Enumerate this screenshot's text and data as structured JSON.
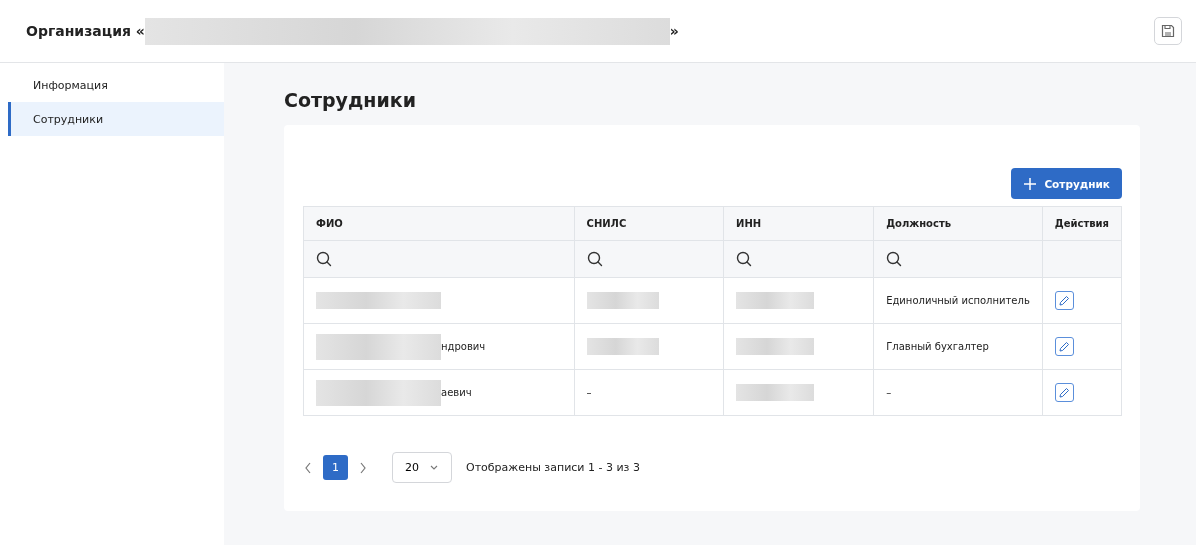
{
  "header": {
    "title_prefix": "Организация «",
    "title_redacted": true,
    "title_suffix": "»"
  },
  "sidebar": {
    "items": [
      {
        "label": "Информация",
        "selected": false
      },
      {
        "label": "Сотрудники",
        "selected": true
      }
    ]
  },
  "page_title": "Сотрудники",
  "add_button": {
    "label": "Сотрудник"
  },
  "table": {
    "columns": [
      {
        "label": "ФИО",
        "searchable": true
      },
      {
        "label": "СНИЛС",
        "searchable": true
      },
      {
        "label": "ИНН",
        "searchable": true
      },
      {
        "label": "Должность",
        "searchable": true
      },
      {
        "label": "Действия",
        "searchable": false
      }
    ],
    "rows": [
      {
        "fio": {
          "redacted": true
        },
        "snils": {
          "redacted": true
        },
        "inn": {
          "redacted": true
        },
        "position": {
          "redacted": false,
          "text": "Единоличный исполнитель"
        }
      },
      {
        "fio": {
          "redacted": true,
          "text": "ндрович"
        },
        "snils": {
          "redacted": true
        },
        "inn": {
          "redacted": true
        },
        "position": {
          "redacted": false,
          "text": "Главный бухгалтер"
        }
      },
      {
        "fio": {
          "redacted": true,
          "text": "аевич"
        },
        "snils": {
          "redacted": false,
          "text": "–"
        },
        "inn": {
          "redacted": true
        },
        "position": {
          "redacted": false,
          "text": "–"
        }
      }
    ]
  },
  "pagination": {
    "pages": [
      {
        "label": "1",
        "selected": true
      }
    ],
    "page_size": "20",
    "summary": "Отображены записи 1 - 3 из 3"
  }
}
